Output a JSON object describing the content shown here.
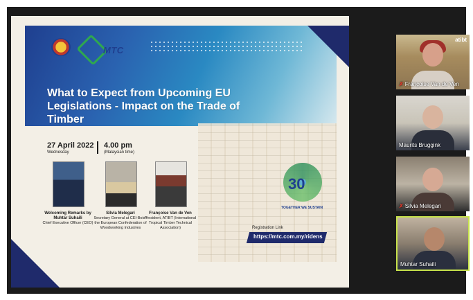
{
  "shared_screen": {
    "title": "What to Expect from Upcoming EU Legislations - Impact on the Trade of Timber",
    "date": "27 April 2022",
    "weekday": "Wednesday",
    "time": "4.00 pm",
    "timezone": "(Malaysian time)",
    "logo_text": "MTC",
    "speakers": [
      {
        "name": "Welcoming Remarks by Muhtar Suhaili",
        "role": "Chief Executive Officer (CEO)"
      },
      {
        "name": "Silvia Melegari",
        "role": "Secretary General at CEI-Bois / the European Confederation of Woodworking Industries"
      },
      {
        "name": "Françoise Van de Ven",
        "role": "President, ATIBT (International Tropical Timber Technical Association)"
      }
    ],
    "anniversary_number": "30",
    "anniversary_tagline": "TOGETHER WE SUSTAIN",
    "registration_label": "Registration Link",
    "registration_link": "https://mtc.com.my/ridens"
  },
  "participants": [
    {
      "name": "Françoise Van de Ven",
      "muted": true,
      "badge": "atibt"
    },
    {
      "name": "Maurits Bruggink",
      "muted": false
    },
    {
      "name": "Silvia Melegari",
      "muted": true
    },
    {
      "name": "Muhtar Suhaili",
      "muted": false,
      "active_speaker": true
    }
  ],
  "icons": {
    "muted": "mic-muted-icon"
  }
}
